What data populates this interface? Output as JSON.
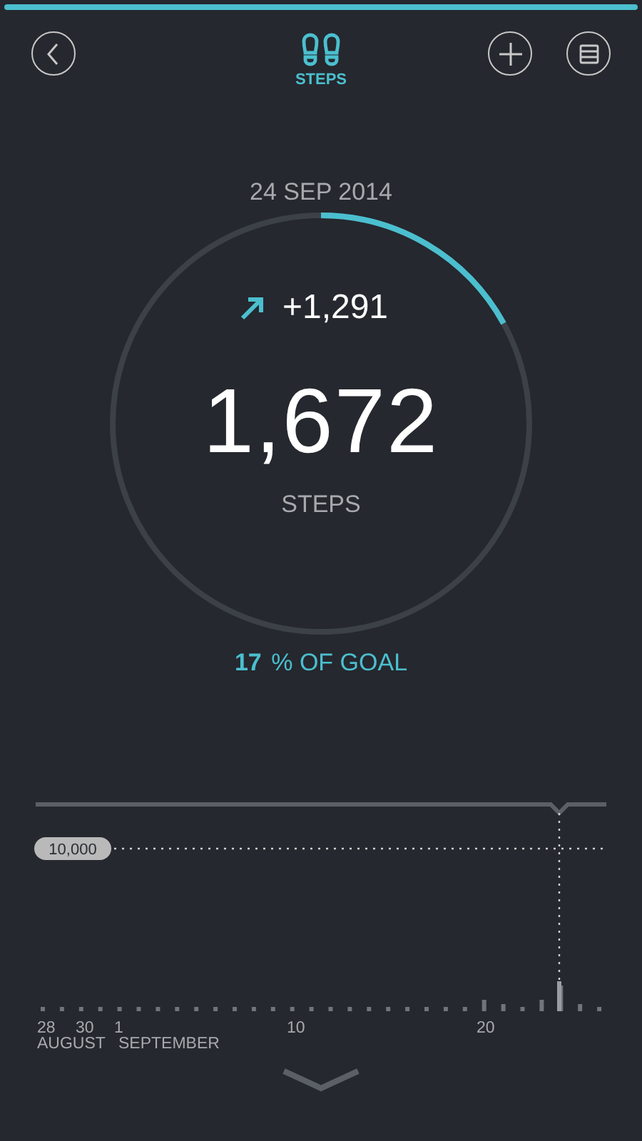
{
  "header": {
    "title": "STEPS"
  },
  "summary": {
    "date": "24 SEP 2014",
    "change": "+1,291",
    "steps": "1,672",
    "unit": "STEPS",
    "goal_percent": "17",
    "goal_text": "% OF GOAL"
  },
  "chart": {
    "goal_label": "10,000",
    "day_labels": [
      "28",
      "30",
      "1",
      "10",
      "20"
    ],
    "month_labels": [
      "AUGUST",
      "SEPTEMBER"
    ]
  }
}
